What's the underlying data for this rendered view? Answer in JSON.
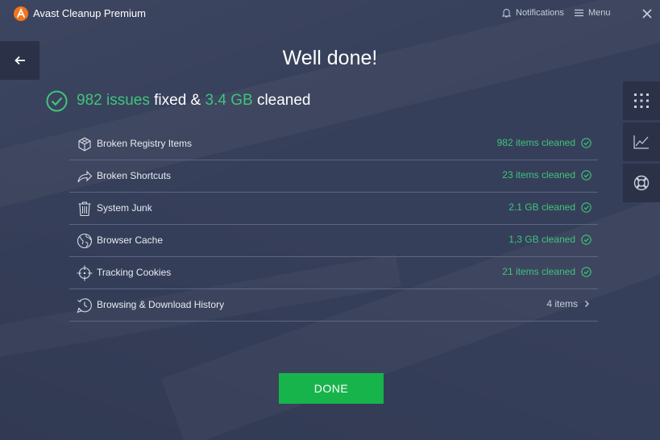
{
  "app": {
    "title": "Avast Cleanup Premium",
    "accent": "#3fc47a",
    "brand": "#f3751c"
  },
  "titlebar": {
    "notifications_label": "Notifications",
    "menu_label": "Menu"
  },
  "heading": "Well done!",
  "summary": {
    "issues_count": "982 issues",
    "fixed_word": "fixed &",
    "size": "3.4 GB",
    "cleaned_word": "cleaned"
  },
  "items": [
    {
      "label": "Broken Registry Items",
      "status": "982 items cleaned",
      "icon": "cube-icon"
    },
    {
      "label": "Broken Shortcuts",
      "status": "23 items cleaned",
      "icon": "shortcut-arrow-icon"
    },
    {
      "label": "System Junk",
      "status": "2.1 GB cleaned",
      "icon": "trash-icon"
    },
    {
      "label": "Browser Cache",
      "status": "1,3 GB cleaned",
      "icon": "globe-icon"
    },
    {
      "label": "Tracking Cookies",
      "status": "21 items cleaned",
      "icon": "crosshair-icon"
    },
    {
      "label": "Browsing & Download History",
      "status": "4 items",
      "icon": "history-icon"
    }
  ],
  "done_label": "DONE"
}
